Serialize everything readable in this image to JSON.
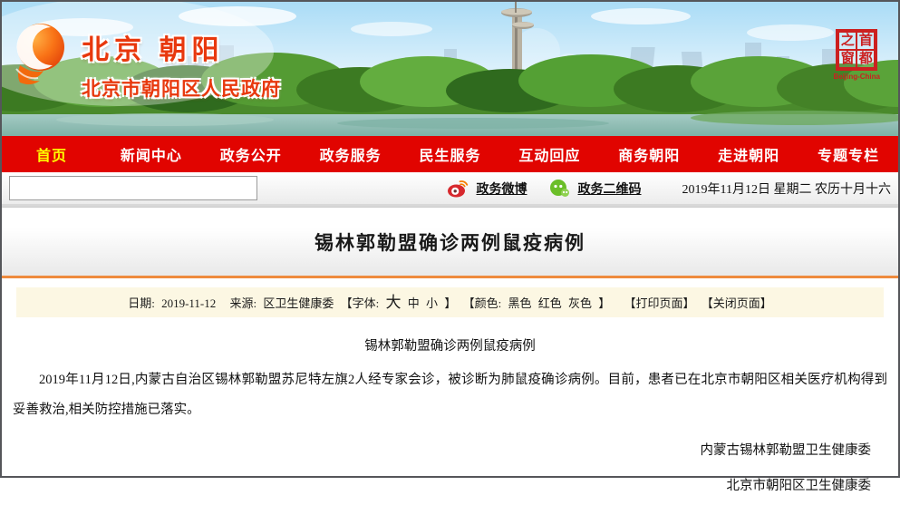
{
  "banner": {
    "logo_title": "北京  朝阳",
    "logo_subtitle": "北京市朝阳区人民政府",
    "seal_chars": [
      "之",
      "首",
      "窗",
      "都"
    ],
    "seal_caption": "Beijing-China"
  },
  "nav": {
    "items": [
      {
        "label": "首页",
        "active": true
      },
      {
        "label": "新闻中心",
        "active": false
      },
      {
        "label": "政务公开",
        "active": false
      },
      {
        "label": "政务服务",
        "active": false
      },
      {
        "label": "民生服务",
        "active": false
      },
      {
        "label": "互动回应",
        "active": false
      },
      {
        "label": "商务朝阳",
        "active": false
      },
      {
        "label": "走进朝阳",
        "active": false
      },
      {
        "label": "专题专栏",
        "active": false
      }
    ]
  },
  "toolbar": {
    "search_value": "",
    "weibo_label": "政务微博",
    "qrcode_label": "政务二维码",
    "date_text": "2019年11月12日  星期二  农历十月十六"
  },
  "article": {
    "title": "锡林郭勒盟确诊两例鼠疫病例",
    "meta": {
      "date_label": "日期:",
      "date": "2019-11-12",
      "source_label": "来源:",
      "source": "区卫生健康委",
      "font_label": "【字体:",
      "font_large": "大",
      "font_medium": "中",
      "font_small": "小",
      "bracket_close_font": "】",
      "color_label": "【颜色:",
      "color_black": "黑色",
      "color_red": "红色",
      "color_gray": "灰色",
      "bracket_close_color": "】",
      "print_label": "【打印页面】",
      "close_label": "【关闭页面】"
    },
    "inner_title": "锡林郭勒盟确诊两例鼠疫病例",
    "paragraph": "2019年11月12日,内蒙古自治区锡林郭勒盟苏尼特左旗2人经专家会诊，被诊断为肺鼠疫确诊病例。目前，患者已在北京市朝阳区相关医疗机构得到妥善救治,相关防控措施已落实。",
    "signatures": [
      "内蒙古锡林郭勒盟卫生健康委",
      "北京市朝阳区卫生健康委"
    ]
  },
  "colors": {
    "nav_red": "#e10400",
    "nav_active_yellow": "#ffff00",
    "orange_rule": "#ee8a3d",
    "meta_bar_bg": "#fcf7e3",
    "seal_red": "#cc2020",
    "logo_red": "#e8380d"
  }
}
